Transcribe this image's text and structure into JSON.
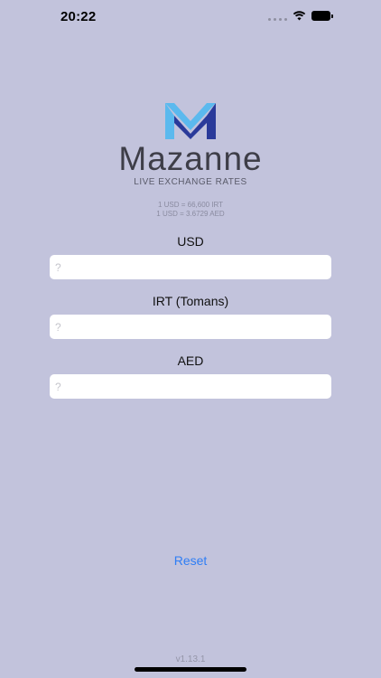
{
  "status_bar": {
    "time": "20:22"
  },
  "brand": {
    "name": "Mazanne",
    "tagline": "LIVE EXCHANGE RATES",
    "logo_colors": [
      "#5bb9ee",
      "#2a3a9a"
    ]
  },
  "rates": {
    "line1": "1 USD = 66,600 IRT",
    "line2": "1 USD = 3.6729 AED"
  },
  "fields": [
    {
      "label": "USD",
      "placeholder": "?",
      "value": ""
    },
    {
      "label": "IRT (Tomans)",
      "placeholder": "?",
      "value": ""
    },
    {
      "label": "AED",
      "placeholder": "?",
      "value": ""
    }
  ],
  "actions": {
    "reset_label": "Reset"
  },
  "version": "v1.13.1",
  "colors": {
    "background": "#c2c3dc",
    "accent": "#2f7ef5"
  }
}
